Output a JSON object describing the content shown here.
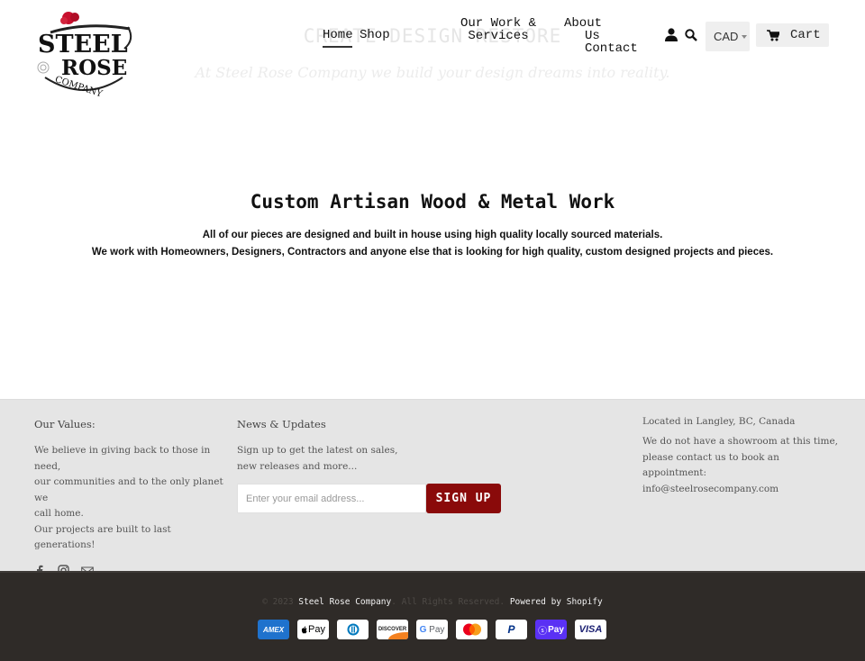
{
  "brand": {
    "logo_line1": "STEEL",
    "logo_line2": "ROSE",
    "logo_line3": "COMPANY",
    "rose_color": "#c8102e"
  },
  "hero": {
    "title": "CREATE DESIGN RESTORE",
    "subtitle": "At Steel Rose Company we build your design dreams into reality."
  },
  "nav": {
    "items": [
      {
        "label": "Home",
        "active": true
      },
      {
        "label": "Shop"
      },
      {
        "label_line1": "Our Work &",
        "label_line2": "Services"
      },
      {
        "label_line1": "About",
        "label_line2": "Us Contact"
      }
    ],
    "account_icon": "user-icon",
    "search_icon": "search-icon",
    "currency": "CAD",
    "cart_label": "Cart",
    "cart_icon": "cart-icon"
  },
  "main": {
    "title": "Custom Artisan Wood & Metal Work",
    "paragraph1": "All of our pieces are designed and built in house using high quality locally sourced materials.",
    "paragraph2": "We work with Homeowners, Designers, Contractors and anyone else that is looking for high quality, custom designed projects and pieces."
  },
  "footer": {
    "values": {
      "heading": "Our Values:",
      "text_lines": [
        "We believe in giving back to those in need,",
        "our communities and to the only planet we",
        "call home.",
        "Our projects are built to last generations!"
      ],
      "social": [
        "facebook-icon",
        "instagram-icon",
        "email-icon"
      ]
    },
    "news": {
      "heading": "News & Updates",
      "text": "Sign up to get the latest on sales, new releases and more...",
      "email_placeholder": "Enter your email address...",
      "signup_label": "SIGN UP",
      "signup_color": "#8a0a0a"
    },
    "contact": {
      "location": "Located in Langley, BC, Canada",
      "text_lines": [
        "We do not have a showroom at this time,",
        "please contact us to book an appointment:",
        "info@steelrosecompany.com"
      ]
    }
  },
  "bottom": {
    "copyright_prefix": "© 2023",
    "company": "Steel Rose Company",
    "rights": ". All Rights Reserved.",
    "powered": "Powered by Shopify",
    "payments": [
      {
        "name": "American Express",
        "label": "AMEX"
      },
      {
        "name": "Apple Pay",
        "label": " Pay"
      },
      {
        "name": "Diners Club",
        "label": "D"
      },
      {
        "name": "Discover",
        "label": "DISCOVER"
      },
      {
        "name": "Google Pay",
        "label": "G Pay"
      },
      {
        "name": "Mastercard",
        "label": ""
      },
      {
        "name": "PayPal",
        "label": "P"
      },
      {
        "name": "Shop Pay",
        "label": "Pay"
      },
      {
        "name": "Visa",
        "label": "VISA"
      }
    ]
  }
}
